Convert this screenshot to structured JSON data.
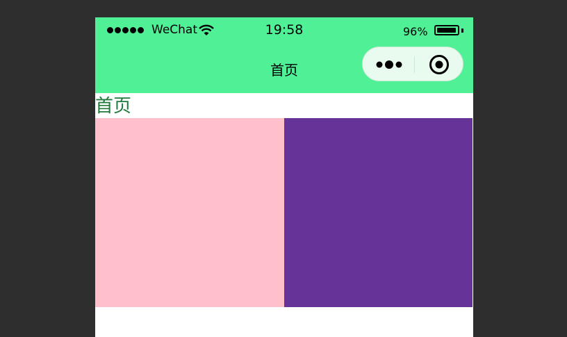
{
  "status_bar": {
    "carrier": "WeChat",
    "time": "19:58",
    "battery_percent": "96%",
    "battery_level": 0.96,
    "signal_icon": "signal-dots-icon",
    "wifi_icon": "wifi-icon"
  },
  "nav_bar": {
    "title": "首页",
    "more_icon": "more-dots-icon",
    "close_icon": "target-close-icon"
  },
  "page": {
    "heading": "首页",
    "boxes": [
      {
        "color": "#ffc0cb"
      },
      {
        "color": "#663399"
      }
    ]
  },
  "colors": {
    "nav_background": "#4ff096",
    "heading_text": "#1f7a3c",
    "outer_background": "#2e2e2e"
  }
}
